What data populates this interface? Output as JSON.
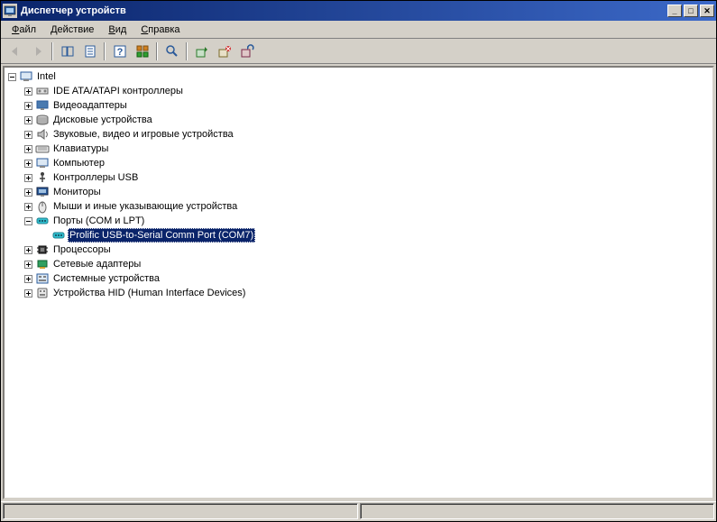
{
  "window": {
    "title": "Диспетчер устройств"
  },
  "menu": {
    "file": "Файл",
    "action": "Действие",
    "view": "Вид",
    "help": "Справка"
  },
  "tree": {
    "root": "Intel",
    "nodes": [
      {
        "label": "IDE ATA/ATAPI контроллеры",
        "icon": "ide"
      },
      {
        "label": "Видеоадаптеры",
        "icon": "display"
      },
      {
        "label": "Дисковые устройства",
        "icon": "disk"
      },
      {
        "label": "Звуковые, видео и игровые устройства",
        "icon": "sound"
      },
      {
        "label": "Клавиатуры",
        "icon": "keyboard"
      },
      {
        "label": "Компьютер",
        "icon": "computer"
      },
      {
        "label": "Контроллеры USB",
        "icon": "usb"
      },
      {
        "label": "Мониторы",
        "icon": "monitor"
      },
      {
        "label": "Мыши и иные указывающие устройства",
        "icon": "mouse"
      },
      {
        "label": "Порты (COM и LPT)",
        "icon": "port",
        "expanded": true,
        "children": [
          {
            "label": "Prolific USB-to-Serial Comm Port (COM7)",
            "icon": "port",
            "selected": true
          }
        ]
      },
      {
        "label": "Процессоры",
        "icon": "cpu"
      },
      {
        "label": "Сетевые адаптеры",
        "icon": "net"
      },
      {
        "label": "Системные устройства",
        "icon": "system"
      },
      {
        "label": "Устройства HID (Human Interface Devices)",
        "icon": "hid"
      }
    ]
  }
}
